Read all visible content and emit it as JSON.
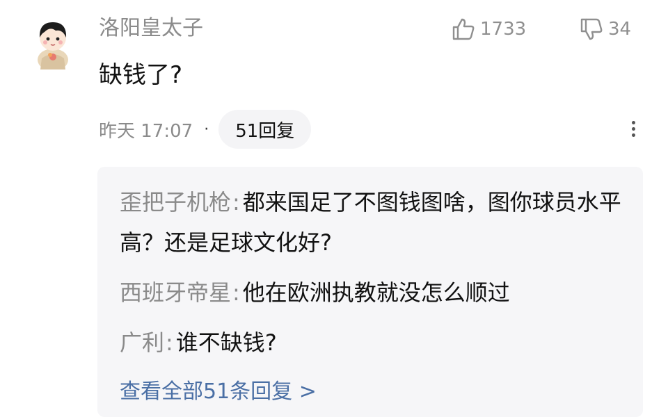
{
  "comment": {
    "author": "洛阳皇太子",
    "like_count": "1733",
    "dislike_count": "34",
    "text": "缺钱了?",
    "time": "昨天 17:07",
    "separator": "·",
    "reply_count_label": "51回复"
  },
  "replies": [
    {
      "name": "歪把子机枪",
      "text": "都来国足了不图钱图啥，图你球员水平高？还是足球文化好?"
    },
    {
      "name": "西班牙帝星",
      "text": "他在欧洲执教就没怎么顺过"
    },
    {
      "name": "广利",
      "text": "谁不缺钱?"
    }
  ],
  "view_all_label": "查看全部51条回复 >",
  "icons": {
    "like": "thumbs-up-icon",
    "dislike": "thumbs-down-icon",
    "more": "more-vertical-icon",
    "avatar": "avatar-icon"
  },
  "colors": {
    "link": "#4a6fa5",
    "muted_text": "#8b8b8b",
    "reply_background": "#f6f6f8"
  }
}
